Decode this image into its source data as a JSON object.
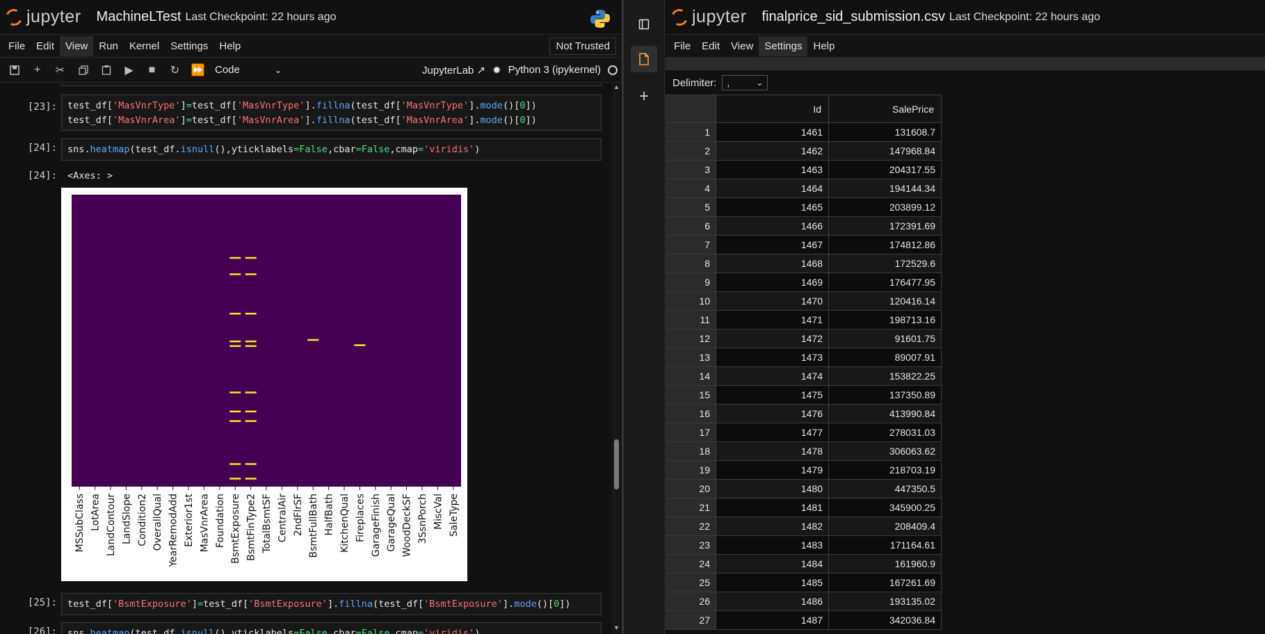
{
  "left": {
    "logo_text": "jupyter",
    "notebook_title": "MachineLTest",
    "checkpoint": "Last Checkpoint: 22 hours ago",
    "menu": [
      "File",
      "Edit",
      "View",
      "Run",
      "Kernel",
      "Settings",
      "Help"
    ],
    "trusted": "Not Trusted",
    "cell_type": "Code",
    "jupyterlab_link": "JupyterLab",
    "kernel_name": "Python 3 (ipykernel)",
    "cells": [
      {
        "prompt": "[23]:",
        "lines": [
          "test_df['MasVnrType']=test_df['MasVnrType'].fillna(test_df['MasVnrType'].mode()[0])",
          "test_df['MasVnrArea']=test_df['MasVnrArea'].fillna(test_df['MasVnrArea'].mode()[0])"
        ]
      },
      {
        "prompt": "[24]:",
        "lines": [
          "sns.heatmap(test_df.isnull(),yticklabels=False,cbar=False,cmap='viridis')"
        ]
      },
      {
        "prompt": "[25]:",
        "lines": [
          "test_df['BsmtExposure']=test_df['BsmtExposure'].fillna(test_df['BsmtExposure'].mode()[0])"
        ]
      },
      {
        "prompt": "[26]:",
        "lines": [
          "sns.heatmap(test_df.isnull(),yticklabels=False,cbar=False,cmap='viridis')"
        ]
      }
    ],
    "output_prompt": "[24]:",
    "output_text": "<Axes: >"
  },
  "chart_data": {
    "type": "heatmap",
    "cmap": "viridis",
    "x_tick_labels": [
      "MSSubClass",
      "LotArea",
      "LandContour",
      "LandSlope",
      "Condition2",
      "OverallQual",
      "YearRemodAdd",
      "Exterior1st",
      "MasVnrArea",
      "Foundation",
      "BsmtExposure",
      "BsmtFinType2",
      "TotalBsmtSF",
      "CentralAir",
      "2ndFlrSF",
      "BsmtFullBath",
      "HalfBath",
      "KitchenQual",
      "Fireplaces",
      "GarageFinish",
      "GarageQual",
      "WoodDeckSF",
      "3SsnPorch",
      "MiscVal",
      "SaleType"
    ],
    "yticklabels": false,
    "cbar": false,
    "missing_marks": [
      {
        "col": 10,
        "rows": [
          0.216,
          0.272,
          0.407,
          0.502,
          0.518,
          0.677,
          0.742,
          0.775,
          0.922,
          0.972
        ]
      },
      {
        "col": 11,
        "rows": [
          0.216,
          0.272,
          0.407,
          0.502,
          0.518,
          0.677,
          0.742,
          0.775,
          0.922,
          0.972
        ]
      },
      {
        "col": 15,
        "rows": [
          0.497
        ]
      },
      {
        "col": 18,
        "rows": [
          0.515
        ]
      }
    ],
    "missing_color": "#fde725",
    "present_color": "#440154"
  },
  "right": {
    "logo_text": "jupyter",
    "file_title": "finalprice_sid_submission.csv",
    "checkpoint": "Last Checkpoint: 22 hours ago",
    "menu": [
      "File",
      "Edit",
      "View",
      "Settings",
      "Help"
    ],
    "delimiter_label": "Delimiter:",
    "delimiter_value": ",",
    "columns": [
      "Id",
      "SalePrice"
    ],
    "rows": [
      [
        "1",
        "1461",
        "131608.7"
      ],
      [
        "2",
        "1462",
        "147968.84"
      ],
      [
        "3",
        "1463",
        "204317.55"
      ],
      [
        "4",
        "1464",
        "194144.34"
      ],
      [
        "5",
        "1465",
        "203899.12"
      ],
      [
        "6",
        "1466",
        "172391.69"
      ],
      [
        "7",
        "1467",
        "174812.86"
      ],
      [
        "8",
        "1468",
        "172529.6"
      ],
      [
        "9",
        "1469",
        "176477.95"
      ],
      [
        "10",
        "1470",
        "120416.14"
      ],
      [
        "11",
        "1471",
        "198713.16"
      ],
      [
        "12",
        "1472",
        "91601.75"
      ],
      [
        "13",
        "1473",
        "89007.91"
      ],
      [
        "14",
        "1474",
        "153822.25"
      ],
      [
        "15",
        "1475",
        "137350.89"
      ],
      [
        "16",
        "1476",
        "413990.84"
      ],
      [
        "17",
        "1477",
        "278031.03"
      ],
      [
        "18",
        "1478",
        "306063.62"
      ],
      [
        "19",
        "1479",
        "218703.19"
      ],
      [
        "20",
        "1480",
        "447350.5"
      ],
      [
        "21",
        "1481",
        "345900.25"
      ],
      [
        "22",
        "1482",
        "208409.4"
      ],
      [
        "23",
        "1483",
        "171164.61"
      ],
      [
        "24",
        "1484",
        "161960.9"
      ],
      [
        "25",
        "1485",
        "167261.69"
      ],
      [
        "26",
        "1486",
        "193135.02"
      ],
      [
        "27",
        "1487",
        "342036.84"
      ]
    ]
  }
}
